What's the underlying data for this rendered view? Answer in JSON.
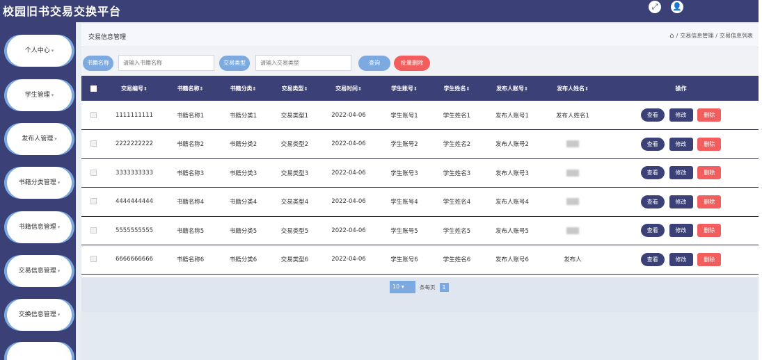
{
  "app": {
    "title": "校园旧书交易交换平台"
  },
  "sidebar": {
    "items": [
      {
        "label": "个人中心"
      },
      {
        "label": "学生管理"
      },
      {
        "label": "发布人管理"
      },
      {
        "label": "书籍分类管理"
      },
      {
        "label": "书籍信息管理"
      },
      {
        "label": "交易信息管理"
      },
      {
        "label": "交换信息管理"
      }
    ]
  },
  "page": {
    "title": "交易信息管理",
    "breadcrumb": [
      "交易信息管理",
      "交易信息列表"
    ],
    "breadcrumb_sep": "/"
  },
  "search": {
    "book_name_label": "书籍名称",
    "book_name_placeholder": "请输入书籍名称",
    "trade_type_label": "交易类型",
    "trade_type_placeholder": "请输入交易类型",
    "search_button": "查询",
    "batch_delete_button": "批量删除"
  },
  "table": {
    "headers": [
      "交易编号",
      "书籍名称",
      "书籍分类",
      "交易类型",
      "交易时间",
      "学生账号",
      "学生姓名",
      "发布人账号",
      "发布人姓名",
      "操作"
    ],
    "rows": [
      {
        "id": "1111111111",
        "book": "书籍名称1",
        "category": "书籍分类1",
        "type": "交易类型1",
        "time": "2022-04-06",
        "acct": "学生账号1",
        "name": "学生姓名1",
        "pub_acct": "发布人账号1",
        "pub_name": "发布人姓名1"
      },
      {
        "id": "2222222222",
        "book": "书籍名称2",
        "category": "书籍分类2",
        "type": "交易类型2",
        "time": "2022-04-06",
        "acct": "学生账号2",
        "name": "学生姓名2",
        "pub_acct": "发布人账号2",
        "pub_name": ""
      },
      {
        "id": "3333333333",
        "book": "书籍名称3",
        "category": "书籍分类3",
        "type": "交易类型3",
        "time": "2022-04-06",
        "acct": "学生账号3",
        "name": "学生姓名3",
        "pub_acct": "发布人账号3",
        "pub_name": ""
      },
      {
        "id": "4444444444",
        "book": "书籍名称4",
        "category": "书籍分类4",
        "type": "交易类型4",
        "time": "2022-04-06",
        "acct": "学生账号4",
        "name": "学生姓名4",
        "pub_acct": "发布人账号4",
        "pub_name": ""
      },
      {
        "id": "5555555555",
        "book": "书籍名称5",
        "category": "书籍分类5",
        "type": "交易类型5",
        "time": "2022-04-06",
        "acct": "学生账号5",
        "name": "学生姓名5",
        "pub_acct": "发布人账号5",
        "pub_name": ""
      },
      {
        "id": "6666666666",
        "book": "书籍名称6",
        "category": "书籍分类6",
        "type": "交易类型6",
        "time": "2022-04-06",
        "acct": "学生账号6",
        "name": "学生姓名6",
        "pub_acct": "发布人账号6",
        "pub_name": "发布人"
      }
    ],
    "actions": {
      "view": "查看",
      "edit": "修改",
      "delete": "删除"
    }
  },
  "pagination": {
    "page_size": "10",
    "per_page_label": "条每页",
    "current_page": "1"
  },
  "colors": {
    "header": "#3b4176",
    "accent": "#7ba9e0",
    "danger": "#f25e5e"
  }
}
